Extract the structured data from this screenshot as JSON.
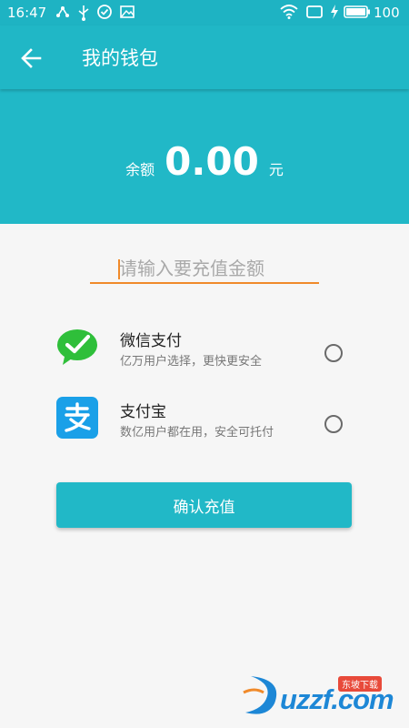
{
  "status_bar": {
    "time": "16:47",
    "battery": "100",
    "icons": [
      "share-icon",
      "usb-icon",
      "check-circle-icon",
      "image-icon",
      "wifi-icon",
      "screen-icon",
      "charging-icon",
      "battery-icon"
    ]
  },
  "app_bar": {
    "title": "我的钱包",
    "back_icon": "arrow-left-icon"
  },
  "balance": {
    "label": "余额",
    "value": "0.00",
    "unit": "元"
  },
  "amount_input": {
    "placeholder": "请输入要充值金额",
    "value": ""
  },
  "payment_methods": [
    {
      "name": "微信支付",
      "desc": "亿万用户选择，更快更安全",
      "icon": "wechat-pay-icon",
      "selected": false
    },
    {
      "name": "支付宝",
      "desc": "数亿用户都在用，安全可托付",
      "icon": "alipay-icon",
      "selected": false
    }
  ],
  "confirm_button": {
    "label": "确认充值"
  },
  "watermark": {
    "text": "uzzf.com",
    "badge": "东坡下载"
  },
  "colors": {
    "primary": "#20b7c6",
    "accent_underline": "#f08a2a",
    "wechat_green": "#2fbf3a",
    "alipay_blue": "#1aa0e8"
  }
}
